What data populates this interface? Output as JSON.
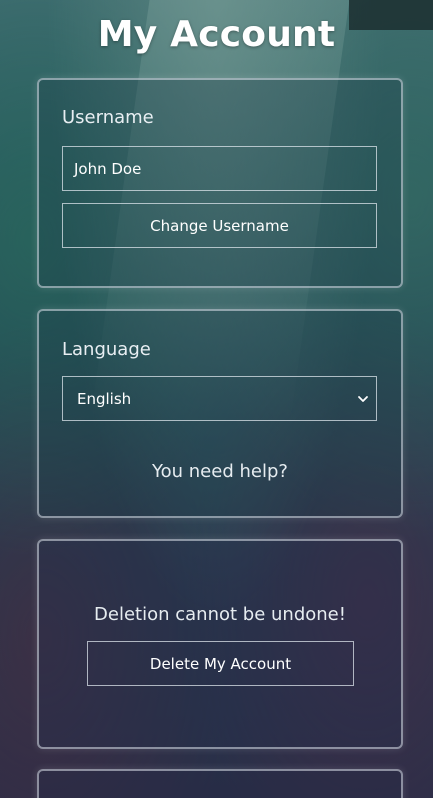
{
  "page_title": "My Account",
  "username_section": {
    "label": "Username",
    "input_value": "John Doe",
    "change_button": "Change Username"
  },
  "language_section": {
    "label": "Language",
    "selected": "English",
    "help_link": "You need help?"
  },
  "delete_section": {
    "warning": "Deletion cannot be undone!",
    "delete_button": "Delete My Account"
  },
  "icons": {
    "dropdown": "chevron-down-icon"
  }
}
